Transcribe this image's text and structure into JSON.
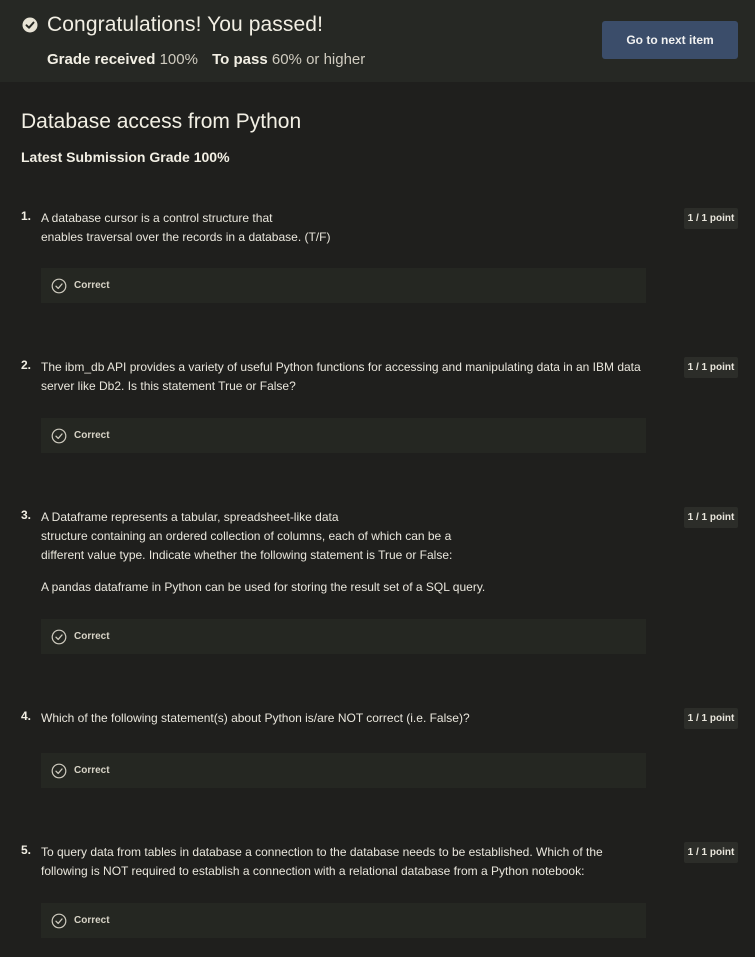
{
  "banner": {
    "title": "Congratulations! You passed!",
    "grade_received_label": "Grade received",
    "grade_received_value": "100%",
    "to_pass_label": "To pass",
    "to_pass_value": "60% or higher",
    "next_button": "Go to next item",
    "accent_color": "#3b4d6a"
  },
  "quiz": {
    "title": "Database access from Python",
    "latest_grade": "Latest Submission Grade 100%"
  },
  "questions": [
    {
      "number": "1.",
      "lines": [
        "A database cursor is a control structure that",
        "enables traversal over the records in a database. (T/F)"
      ],
      "extra": "",
      "points": "1 / 1 point",
      "result": "Correct"
    },
    {
      "number": "2.",
      "lines": [
        "The ibm_db API provides a variety of useful Python functions for accessing and manipulating data in an IBM data",
        "server like Db2. Is this statement True or False?"
      ],
      "extra": "",
      "points": "1 / 1 point",
      "result": "Correct"
    },
    {
      "number": "3.",
      "lines": [
        "A Dataframe represents a tabular, spreadsheet-like data",
        "structure containing an ordered collection of columns, each of which can be a",
        "different value type. Indicate whether the following statement is True or False:"
      ],
      "extra": "A pandas dataframe in Python can be used for storing the result set of a SQL query.",
      "points": "1 / 1 point",
      "result": "Correct"
    },
    {
      "number": "4.",
      "lines": [
        "Which of the following statement(s) about Python is/are NOT correct (i.e. False)?"
      ],
      "extra": "",
      "points": "1 / 1 point",
      "result": "Correct"
    },
    {
      "number": "5.",
      "lines": [
        "To query data from tables in database a connection to the database needs to be established. Which of the",
        "following is NOT required to establish a connection with a relational database from a Python notebook:"
      ],
      "extra": "",
      "points": "1 / 1 point",
      "result": "Correct"
    }
  ]
}
